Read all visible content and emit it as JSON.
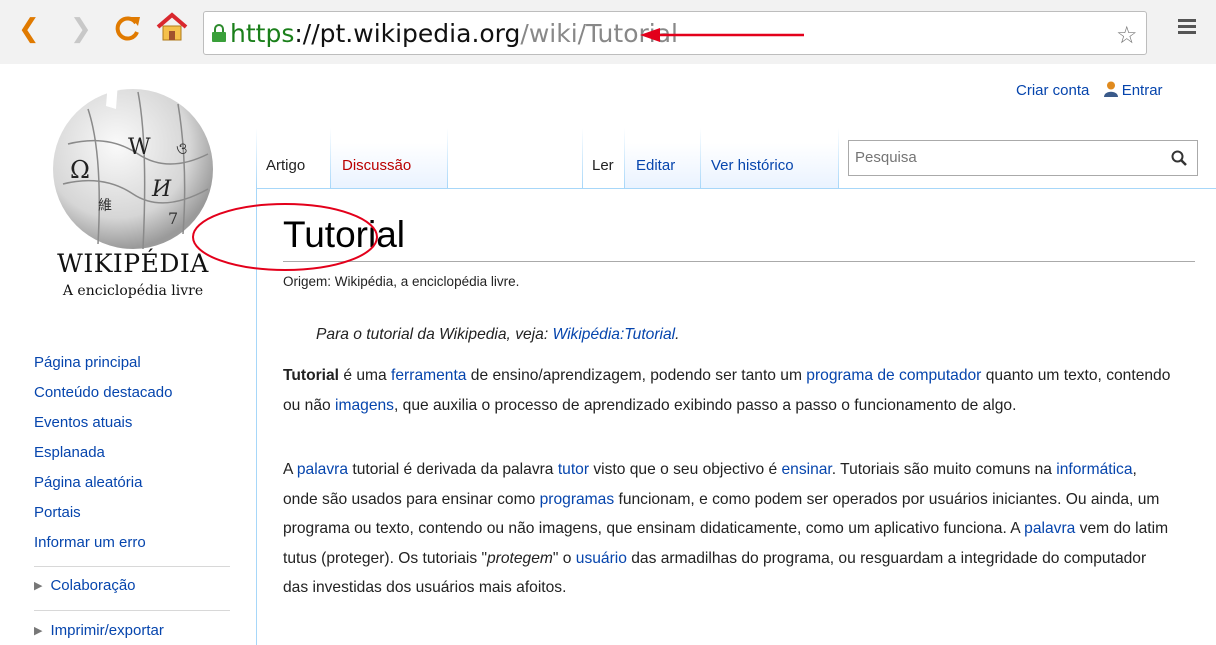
{
  "browser": {
    "back_icon": "back-arrow-icon",
    "forward_icon": "forward-arrow-icon",
    "reload_icon": "reload-icon",
    "home_icon": "home-icon",
    "url_scheme": "https",
    "url_sep": "://",
    "url_host": "pt.wikipedia.org",
    "url_path": "/wiki/Tutorial",
    "star_icon": "star-icon",
    "menu_icon": "hamburger-menu-icon",
    "annotation_color": "#e3001b"
  },
  "personal": {
    "create_account": "Criar conta",
    "login": "Entrar"
  },
  "logo": {
    "wordmark": "WIKIPÉDIA",
    "tagline": "A enciclopédia livre"
  },
  "sidebar": {
    "items": [
      {
        "label": "Página principal"
      },
      {
        "label": "Conteúdo destacado"
      },
      {
        "label": "Eventos atuais"
      },
      {
        "label": "Esplanada"
      },
      {
        "label": "Página aleatória"
      },
      {
        "label": "Portais"
      },
      {
        "label": "Informar um erro"
      }
    ],
    "portlets": [
      {
        "label": "Colaboração"
      },
      {
        "label": "Imprimir/exportar"
      }
    ]
  },
  "tabs": {
    "article": "Artigo",
    "talk": "Discussão",
    "read": "Ler",
    "edit": "Editar",
    "history": "Ver histórico"
  },
  "search": {
    "placeholder": "Pesquisa"
  },
  "article": {
    "title": "Tutorial",
    "siteSub": "Origem: Wikipédia, a enciclopédia livre.",
    "hatnote_prefix": "Para o tutorial da Wikipedia, veja: ",
    "hatnote_link": "Wikipédia:Tutorial",
    "hatnote_suffix": ".",
    "p1": {
      "t1": "Tutorial",
      "t2": " é uma ",
      "l1": "ferramenta",
      "t3": " de ensino/aprendizagem, podendo ser tanto um ",
      "l2": "programa de computador",
      "t4": " quanto um texto, contendo ou não ",
      "l3": "imagens",
      "t5": ", que auxilia o processo de aprendizado exibindo passo a passo o funcionamento de algo."
    },
    "p2": {
      "t1": "A ",
      "l1": "palavra",
      "t2": " tutorial é derivada da palavra ",
      "l2": "tutor",
      "t3": " visto que o seu objectivo é ",
      "l3": "ensinar",
      "t4": ". Tutoriais são muito comuns na ",
      "l4": "informática",
      "t5": ", onde são usados para ensinar como ",
      "l5": "programas",
      "t6": " funcionam, e como podem ser operados por usuários iniciantes. Ou ainda, um programa ou texto, contendo ou não imagens, que ensinam didaticamente, como um aplicativo funciona. A ",
      "l6": "palavra",
      "t7": " vem do latim tutus (proteger). Os tutoriais \"",
      "i1": "protegem",
      "t8": "\" o ",
      "l7": "usuário",
      "t9": " das armadilhas do programa, ou resguardam a integridade do computador das investidas dos usuários mais afoitos."
    }
  }
}
